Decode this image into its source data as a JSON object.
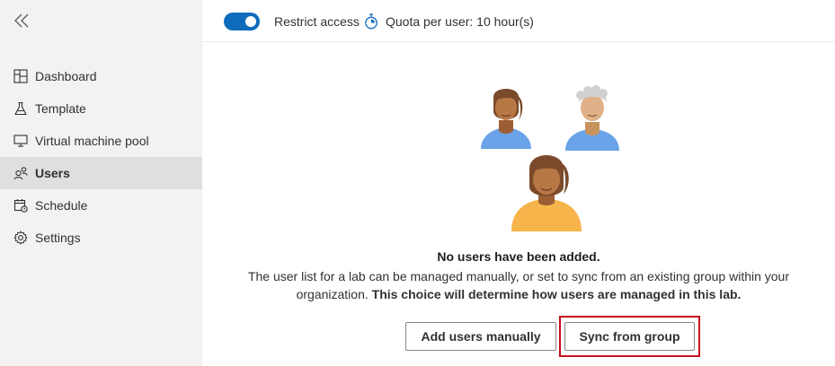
{
  "sidebar": {
    "collapse_icon": "double-chevron-left-icon",
    "items": [
      {
        "label": "Dashboard",
        "icon": "dashboard-icon",
        "active": false
      },
      {
        "label": "Template",
        "icon": "flask-icon",
        "active": false
      },
      {
        "label": "Virtual machine pool",
        "icon": "monitor-icon",
        "active": false
      },
      {
        "label": "Users",
        "icon": "users-icon",
        "active": true
      },
      {
        "label": "Schedule",
        "icon": "calendar-icon",
        "active": false
      },
      {
        "label": "Settings",
        "icon": "gear-icon",
        "active": false
      }
    ]
  },
  "toolbar": {
    "restrict_access_label": "Restrict access",
    "restrict_access_on": true,
    "quota_label": "Quota per user: 10 hour(s)"
  },
  "empty_state": {
    "title": "No users have been added.",
    "description_line1": "The user list for a lab can be managed manually, or set to sync from an existing group within your",
    "description_line2_prefix": "organization.",
    "description_line2_bold": "This choice will determine how users are managed in this lab."
  },
  "actions": {
    "add_manually_label": "Add users manually",
    "sync_group_label": "Sync from group"
  },
  "colors": {
    "accent": "#0f6cbd",
    "sidebar_bg": "#f3f2f1",
    "active_item_bg": "#e1dfdd",
    "highlight": "#c50f1f"
  }
}
